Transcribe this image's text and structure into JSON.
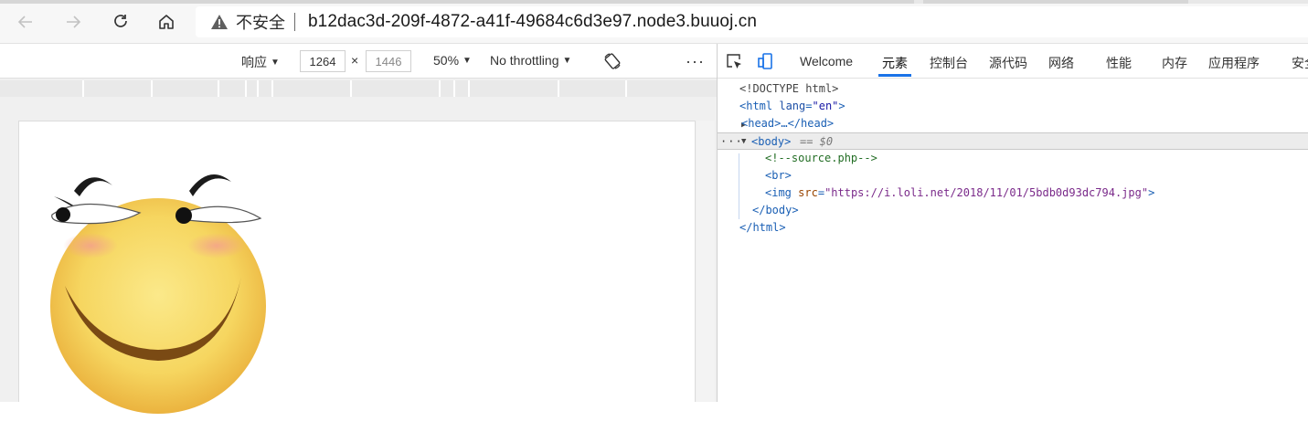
{
  "browser": {
    "back_label": "Back",
    "forward_label": "Forward",
    "reload_label": "Reload",
    "home_label": "Home",
    "security_label": "不安全",
    "url": "b12dac3d-209f-4872-a41f-49684c6d3e97.node3.buuoj.cn"
  },
  "device_toolbar": {
    "dimensions_mode": "响应",
    "width_value": "1264",
    "times_sign": "×",
    "height_placeholder": "1446",
    "zoom": "50%",
    "throttling": "No throttling",
    "rotate_icon": "rotate-icon",
    "more_icon": "more-options-icon"
  },
  "page": {
    "image_description_icon": "smiling-face-emoji-image"
  },
  "devtools": {
    "tabs": [
      {
        "label": "Welcome"
      },
      {
        "label": "元素"
      },
      {
        "label": "控制台"
      },
      {
        "label": "源代码"
      },
      {
        "label": "网络"
      },
      {
        "label": "性能"
      },
      {
        "label": "内存"
      },
      {
        "label": "应用程序"
      },
      {
        "label": "安全"
      }
    ],
    "active_tab": "元素",
    "dom": {
      "doctype": "<!DOCTYPE html>",
      "html_open_tag": "<html",
      "html_attr_name": "lang",
      "html_attr_eq": "=",
      "html_attr_value": "\"en\"",
      "html_open_close": ">",
      "head_collapsed": "<head>…</head>",
      "body_open": "<body>",
      "body_selected_marker": "== $0",
      "comment": "<!--source.php-->",
      "br": "<br>",
      "img_open": "<img",
      "img_attr_name": "src",
      "img_attr_eq": "=",
      "img_attr_value": "\"https://i.loli.net/2018/11/01/5bdb0d93dc794.jpg\"",
      "img_close": ">",
      "body_close": "</body>",
      "html_close": "</html>",
      "dots": "···"
    }
  },
  "colors": {
    "accent": "#1a73e8",
    "tag": "#881280",
    "attr": "#994500",
    "value": "#1a1aa6",
    "comment": "#236e25",
    "emoji_face": "#f7d35c"
  }
}
